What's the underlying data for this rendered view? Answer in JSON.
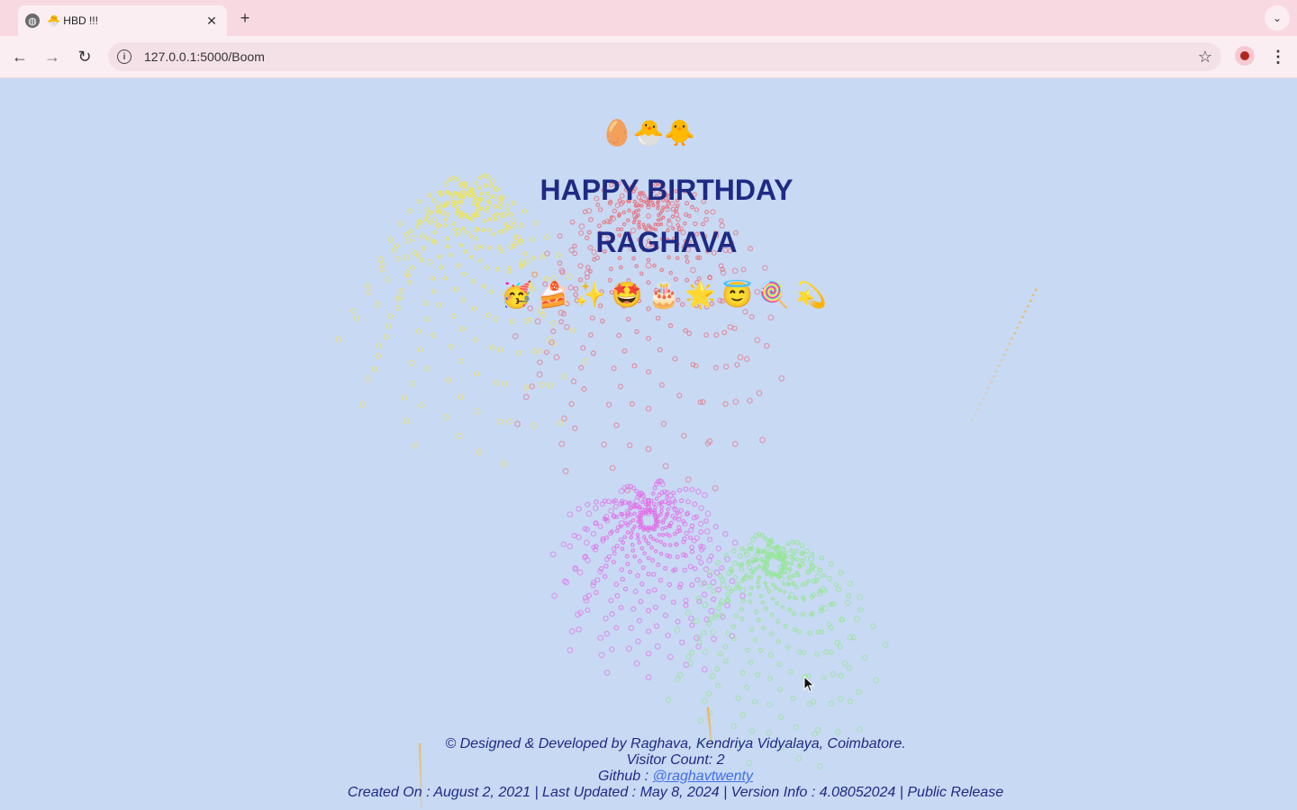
{
  "browser": {
    "tab_title": "🐣 HBD !!!",
    "url": "127.0.0.1:5000/Boom"
  },
  "page": {
    "chicks": "🥚🐣🐥",
    "heading_line1": "HAPPY BIRTHDAY",
    "heading_line2": "RAGHAVA",
    "emoji_row": "🥳🍰✨🤩🎂🌟😇🍭💫",
    "footer": {
      "credit": "© Designed & Developed by Raghava, Kendriya Vidyalaya, Coimbatore.",
      "visitor": "Visitor Count: 2",
      "github_prefix": "Github : ",
      "github_link": "@raghavtwenty",
      "info": "Created On : August 2, 2021 | Last Updated : May 8, 2024 | Version Info : 4.08052024 | Public Release"
    }
  },
  "colors": {
    "background": "#c8d9f4",
    "heading": "#1e2a84",
    "link": "#3f6ee8",
    "firework_yellow": "#f2e64a",
    "firework_pink": "#e070e8",
    "firework_green": "#8fe88a",
    "firework_red": "#e8707a",
    "firework_orange": "#f0b84a"
  },
  "icons": [
    "globe-icon",
    "close-icon",
    "plus-icon",
    "chevron-down-icon",
    "back-arrow-icon",
    "forward-arrow-icon",
    "reload-icon",
    "info-icon",
    "star-icon",
    "profile-icon",
    "kebab-menu-icon",
    "mouse-cursor-icon"
  ]
}
